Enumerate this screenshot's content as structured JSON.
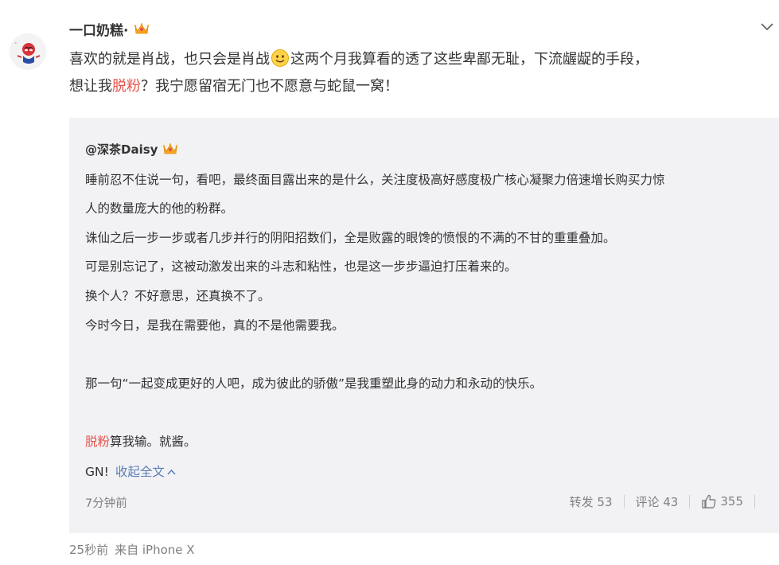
{
  "post": {
    "username": "一口奶糕·",
    "text_part1": "喜欢的就是肖战，也只会是肖战",
    "text_part2": "这两个月我算看的透了这些卑鄙无耻，下流龌龊的手段，",
    "text_part3": "想让我",
    "text_red": "脱粉",
    "text_part4": "？我宁愿留宿无门也不愿意与蛇鼠一窝！"
  },
  "quote": {
    "username": "@深茶Daisy",
    "lines": [
      "睡前忍不住说一句，看吧，最终面目露出来的是什么，关注度极高好感度极广核心凝聚力倍速增长购买力惊",
      "人的数量庞大的他的粉群。",
      "诛仙之后一步一步或者几步并行的阴阳招数们，全是败露的眼馋的愤恨的不满的不甘的重重叠加。",
      "可是别忘记了，这被动激发出来的斗志和粘性，也是这一步步逼迫打压着来的。",
      "换个人？不好意思，还真换不了。",
      "今时今日，是我在需要他，真的不是他需要我。",
      "那一句“一起变成更好的人吧，成为彼此的骄傲”是我重塑此身的动力和永动的快乐。"
    ],
    "red_prefix": "脱粉",
    "red_suffix": "算我输。就酱。",
    "gn": "GN!",
    "collapse_label": "收起全文",
    "time": "7分钟前",
    "repost": "转发 53",
    "comment": "评论 43",
    "like_count": "355"
  },
  "footer": {
    "time": "25秒前",
    "source": "来自 iPhone X"
  },
  "colors": {
    "accent_red": "#e8524c",
    "link_blue": "#5b7fb5",
    "quote_bg": "#f2f2f5"
  },
  "icons": [
    "avatar-spiderman",
    "crown-icon",
    "smiley-icon",
    "chevron-down-icon",
    "chevron-up-icon",
    "thumb-up-icon"
  ]
}
